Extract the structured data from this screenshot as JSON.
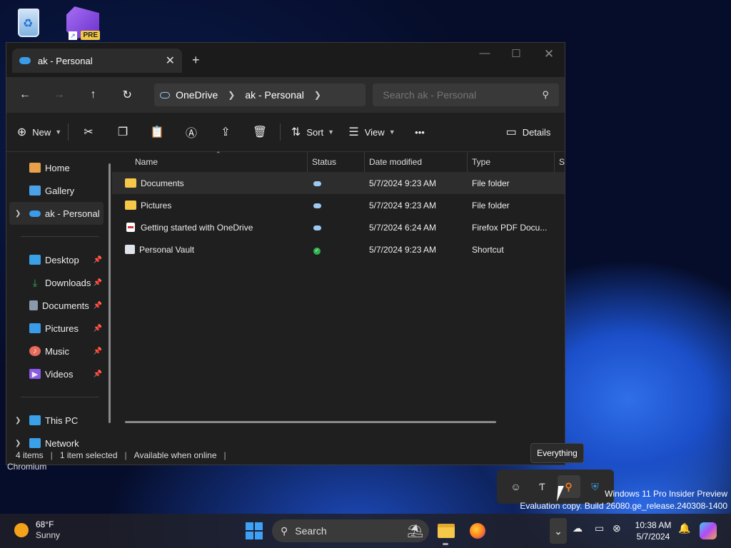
{
  "desktop": {
    "icons": [
      "recycle-bin",
      "visual-studio-preview"
    ],
    "vs_badge": "PRE",
    "partial_label": "Chromium",
    "watermark_line1": "Windows 11 Pro Insider Preview",
    "watermark_line2": "Evaluation copy. Build 26080.ge_release.240308-1400"
  },
  "window": {
    "tab_title": "ak - Personal",
    "tab_close": "✕",
    "new_tab": "+",
    "controls": {
      "minimize": "—",
      "maximize": "☐",
      "close": "✕"
    }
  },
  "nav": {
    "back": "←",
    "forward": "→",
    "up": "↑",
    "refresh": "↻",
    "breadcrumb": [
      "OneDrive",
      "ak - Personal"
    ],
    "search_placeholder": "Search ak - Personal"
  },
  "toolbar": {
    "new_label": "New",
    "sort_label": "Sort",
    "view_label": "View",
    "more_label": "•••",
    "details_label": "Details",
    "icons": [
      "cut-icon",
      "copy-icon",
      "paste-icon",
      "rename-icon",
      "share-icon",
      "delete-icon"
    ]
  },
  "sidebar": {
    "top": [
      {
        "label": "Home",
        "icon": "home-icon",
        "color": "#e8a04a"
      },
      {
        "label": "Gallery",
        "icon": "gallery-icon",
        "color": "#4aa3e8"
      },
      {
        "label": "ak - Personal",
        "icon": "onedrive-icon",
        "color": "#3a9be8"
      }
    ],
    "pinned": [
      {
        "label": "Desktop",
        "icon": "desktop-icon",
        "color": "#3aa0e8"
      },
      {
        "label": "Downloads",
        "icon": "downloads-icon",
        "color": "#33b06a"
      },
      {
        "label": "Documents",
        "icon": "documents-icon",
        "color": "#8a9aab"
      },
      {
        "label": "Pictures",
        "icon": "pictures-icon",
        "color": "#3a9be8"
      },
      {
        "label": "Music",
        "icon": "music-icon",
        "color": "#e86a5a"
      },
      {
        "label": "Videos",
        "icon": "videos-icon",
        "color": "#8a5ae8"
      }
    ],
    "bottom": [
      {
        "label": "This PC",
        "icon": "this-pc-icon",
        "color": "#3aa0e8"
      },
      {
        "label": "Network",
        "icon": "network-icon",
        "color": "#3aa0e8"
      }
    ]
  },
  "columns": [
    "Name",
    "Status",
    "Date modified",
    "Type",
    "S"
  ],
  "files": [
    {
      "name": "Documents",
      "status": "cloud",
      "date": "5/7/2024 9:23 AM",
      "type": "File folder",
      "kind": "folder"
    },
    {
      "name": "Pictures",
      "status": "cloud",
      "date": "5/7/2024 9:23 AM",
      "type": "File folder",
      "kind": "folder"
    },
    {
      "name": "Getting started with OneDrive",
      "status": "cloud",
      "date": "5/7/2024 6:24 AM",
      "type": "Firefox PDF Docu...",
      "kind": "pdf"
    },
    {
      "name": "Personal Vault",
      "status": "synced",
      "date": "5/7/2024 9:23 AM",
      "type": "Shortcut",
      "kind": "shortcut"
    }
  ],
  "status": {
    "items": "4 items",
    "selected": "1 item selected",
    "availability": "Available when online"
  },
  "tray_popup": {
    "tooltip": "Everything",
    "icons": [
      "discord-icon",
      "typora-icon",
      "everything-icon",
      "defender-warning-icon"
    ]
  },
  "taskbar": {
    "weather_temp": "68°F",
    "weather_cond": "Sunny",
    "search_label": "Search",
    "time": "10:38 AM",
    "date": "5/7/2024",
    "chevron": "⌃"
  }
}
